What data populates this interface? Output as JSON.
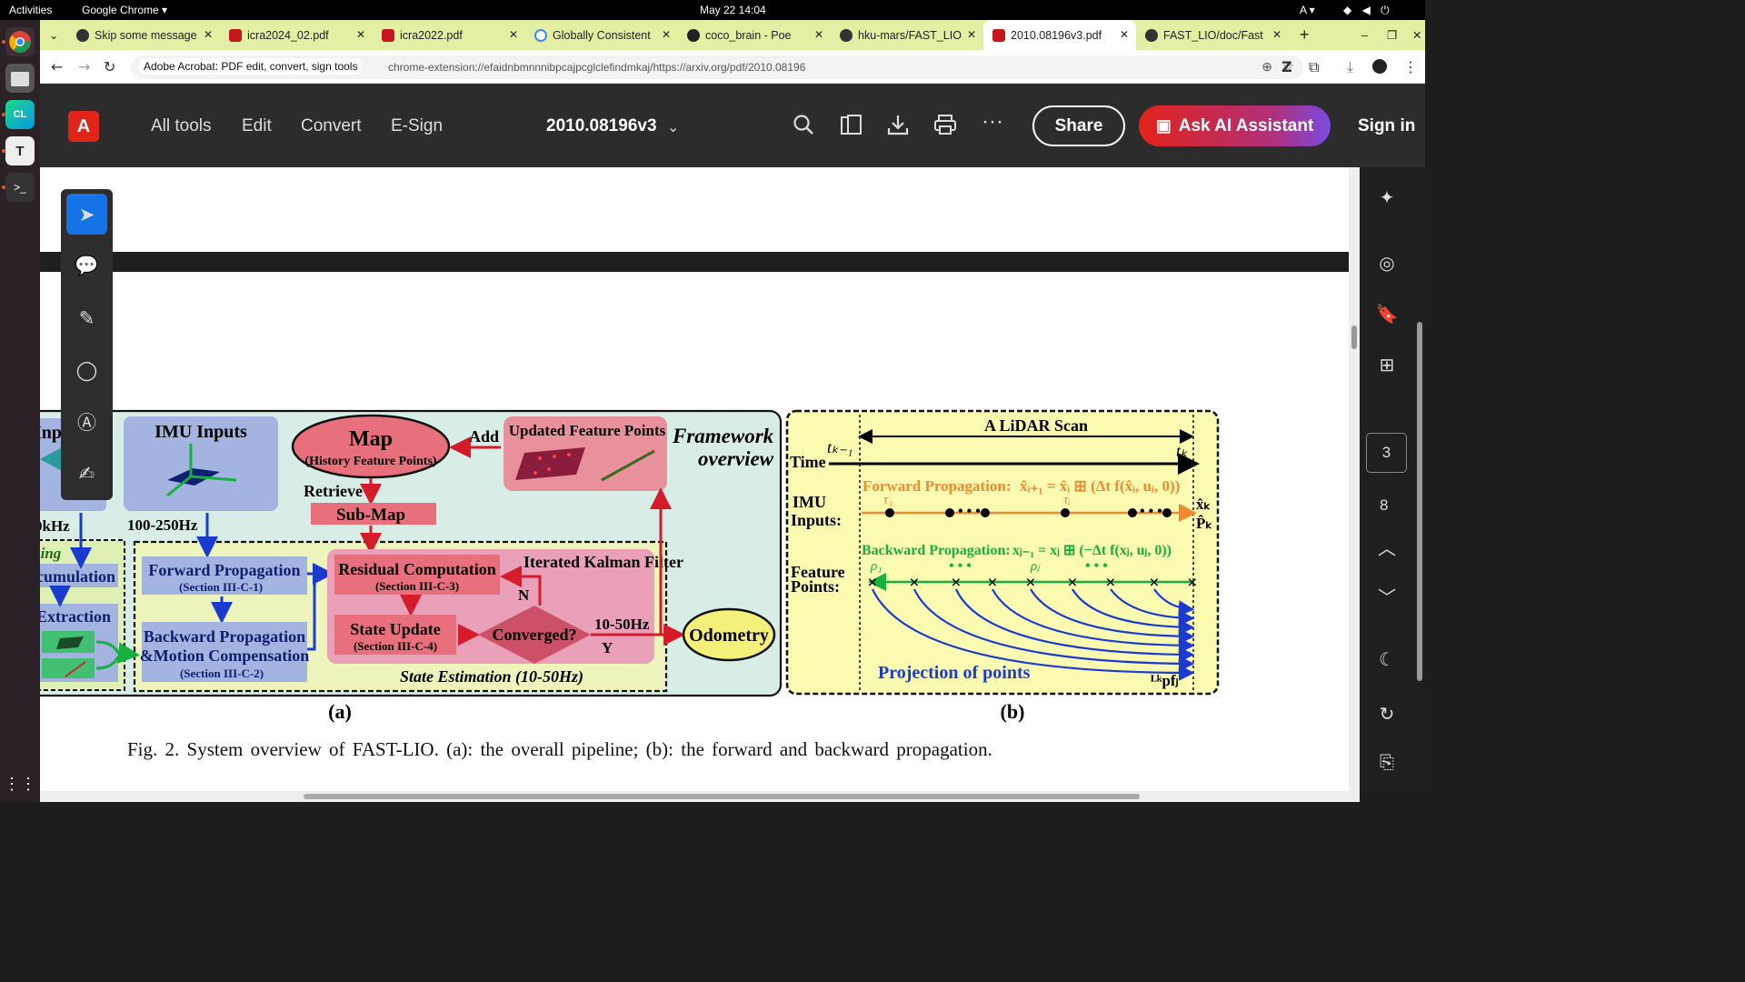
{
  "topbar": {
    "activities": "Activities",
    "app": "Google Chrome ▾",
    "clock": "May 22  14:04",
    "lang": "A ▾"
  },
  "tabs": [
    {
      "label": "Skip some message",
      "color": "#333"
    },
    {
      "label": "icra2024_02.pdf",
      "color": "#c4161c"
    },
    {
      "label": "icra2022.pdf",
      "color": "#c4161c"
    },
    {
      "label": "Globally Consistent",
      "color": "#4285f4"
    },
    {
      "label": "coco_brain - Poe",
      "color": "#222"
    },
    {
      "label": "hku-mars/FAST_LIO",
      "color": "#333"
    },
    {
      "label": "2010.08196v3.pdf",
      "color": "#c4161c"
    },
    {
      "label": "FAST_LIO/doc/Fast",
      "color": "#333"
    }
  ],
  "address": {
    "site": "Adobe Acrobat: PDF edit, convert, sign tools",
    "url": "chrome-extension://efaidnbmnnnibpcajpcglclefindmkaj/https://arxiv.org/pdf/2010.08196"
  },
  "acrobat": {
    "menu": [
      "All tools",
      "Edit",
      "Convert",
      "E-Sign"
    ],
    "doc_name": "2010.08196v3",
    "share": "Share",
    "ai": "Ask AI Assistant",
    "signin": "Sign in"
  },
  "viewer": {
    "page_current": "3",
    "page_total": "8"
  },
  "figure": {
    "a_label": "(a)",
    "b_label": "(b)",
    "framework1": "Framework",
    "framework2": "overview",
    "imu_inputs": "IMU Inputs",
    "imu_rate": "100-250Hz",
    "lidar_frag1": "Inp",
    "lidar_rate_frag": "0kHz",
    "pre_frag1": "sing",
    "pre_frag2": "cumulation",
    "pre_frag3": "Extraction",
    "map_title": "Map",
    "map_sub": "(History Feature Points)",
    "add": "Add",
    "updated": "Updated Feature Points",
    "retrieve": "Retrieve",
    "submap": "Sub-Map",
    "fwd": "Forward Propagation",
    "fwd_sec": "(Section III-C-1)",
    "bwd1": "Backward Propagation",
    "bwd2": "&Motion Compensation",
    "bwd_sec": "(Section III-C-2)",
    "residual": "Residual Computation",
    "residual_sec": "(Section III-C-3)",
    "ikf": "Iterated Kalman Filter",
    "n": "N",
    "y": "Y",
    "state_update": "State Update",
    "state_sec": "(Section III-C-4)",
    "converged": "Converged?",
    "rate_out": "10-50Hz",
    "odometry": "Odometry",
    "state_est": "State Estimation (10-50Hz)",
    "scan": "A LiDAR Scan",
    "tk1": "tₖ₋₁",
    "tk": "tₖ",
    "time": "Time",
    "imu1": "IMU",
    "imu2": "Inputs:",
    "fp_label": "Forward Propagation:",
    "fp_eq": "x̂ᵢ₊₁ = x̂ᵢ ⊞ (Δt f(x̂ᵢ, uᵢ, 0))",
    "tau1": "τ₁",
    "taui": "τᵢ",
    "xk": "x̂ₖ",
    "pk": "P̂ₖ",
    "bp_label": "Backward Propagation:",
    "bp_eq": "xⱼ₋₁ = xⱼ ⊞ (−Δt f(xⱼ, uⱼ, 0))",
    "rho1": "ρ₁",
    "rhoj": "ρⱼ",
    "feat1": "Feature",
    "feat2": "Points:",
    "projection": "Projection of points",
    "lkp": "ᴸᵏpfⱼ",
    "caption": "Fig. 2.   System overview of FAST-LIO. (a): the overall pipeline; (b): the forward and backward propagation."
  }
}
